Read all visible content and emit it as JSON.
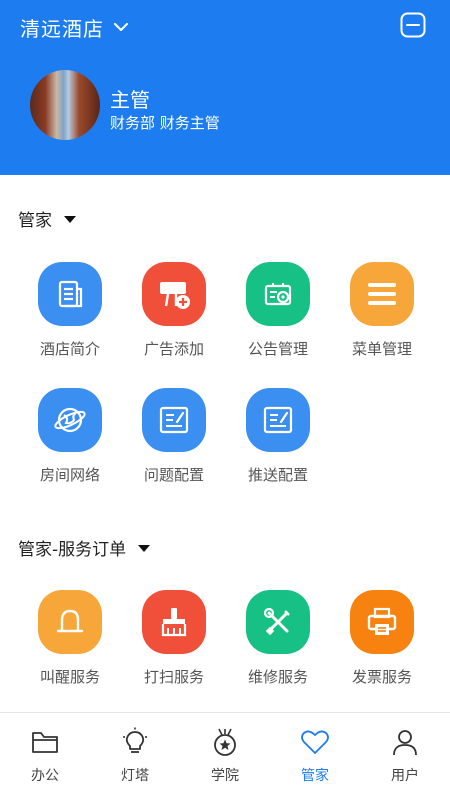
{
  "header": {
    "hotel_name": "清远酒店",
    "user_name": "主管",
    "user_role": "财务部 财务主管"
  },
  "sections": [
    {
      "title": "管家",
      "items": [
        {
          "label": "酒店简介",
          "icon": "document-icon",
          "color": "#3b8ff0"
        },
        {
          "label": "广告添加",
          "icon": "billboard-add-icon",
          "color": "#f0503a"
        },
        {
          "label": "公告管理",
          "icon": "notice-settings-icon",
          "color": "#17c085"
        },
        {
          "label": "菜单管理",
          "icon": "menu-lines-icon",
          "color": "#f7a63a"
        },
        {
          "label": "房间网络",
          "icon": "globe-icon",
          "color": "#3b8ff0"
        },
        {
          "label": "问题配置",
          "icon": "edit-note-icon",
          "color": "#3b8ff0"
        },
        {
          "label": "推送配置",
          "icon": "edit-note-icon",
          "color": "#3b8ff0"
        }
      ]
    },
    {
      "title": "管家-服务订单",
      "items": [
        {
          "label": "叫醒服务",
          "icon": "bell-icon",
          "color": "#f7a63a"
        },
        {
          "label": "打扫服务",
          "icon": "broom-icon",
          "color": "#f0503a"
        },
        {
          "label": "维修服务",
          "icon": "tools-icon",
          "color": "#17c085"
        },
        {
          "label": "发票服务",
          "icon": "printer-icon",
          "color": "#f7820f"
        }
      ]
    }
  ],
  "tabbar": {
    "items": [
      {
        "label": "办公",
        "icon": "folder-icon",
        "active": false
      },
      {
        "label": "灯塔",
        "icon": "lightbulb-icon",
        "active": false
      },
      {
        "label": "学院",
        "icon": "badge-star-icon",
        "active": false
      },
      {
        "label": "管家",
        "icon": "heart-icon",
        "active": true
      },
      {
        "label": "用户",
        "icon": "user-icon",
        "active": false
      }
    ]
  },
  "colors": {
    "primary": "#1c7cf0",
    "blue": "#3b8ff0",
    "red": "#f0503a",
    "green": "#17c085",
    "orange": "#f7a63a",
    "deep_orange": "#f7820f"
  }
}
